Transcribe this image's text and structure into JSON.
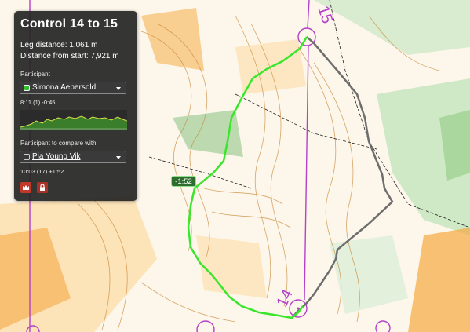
{
  "panel": {
    "title": "Control 14 to 15",
    "leg_distance": "Leg distance: 1,061 m",
    "distance_from_start": "Distance from start: 7,921 m",
    "participant_heading": "Participant",
    "participant": {
      "name": "Simona Aebersold",
      "color": "#2fbf2f"
    },
    "participant_split": "8:11 (1) -0:45",
    "compare_heading": "Participant to compare with",
    "compare_participant": {
      "name": "Pia Young Vik"
    },
    "compare_split": "10:03 (17) +1:52",
    "buttons": [
      {
        "icon": "crown-icon"
      },
      {
        "icon": "lock-icon"
      }
    ]
  },
  "map": {
    "time_diff_label": "-1:52",
    "control_numbers": [
      "15",
      "14"
    ],
    "route_colors": {
      "participant": "#39e62c",
      "compare": "#6e6e6e",
      "course": "#b540c9"
    }
  }
}
